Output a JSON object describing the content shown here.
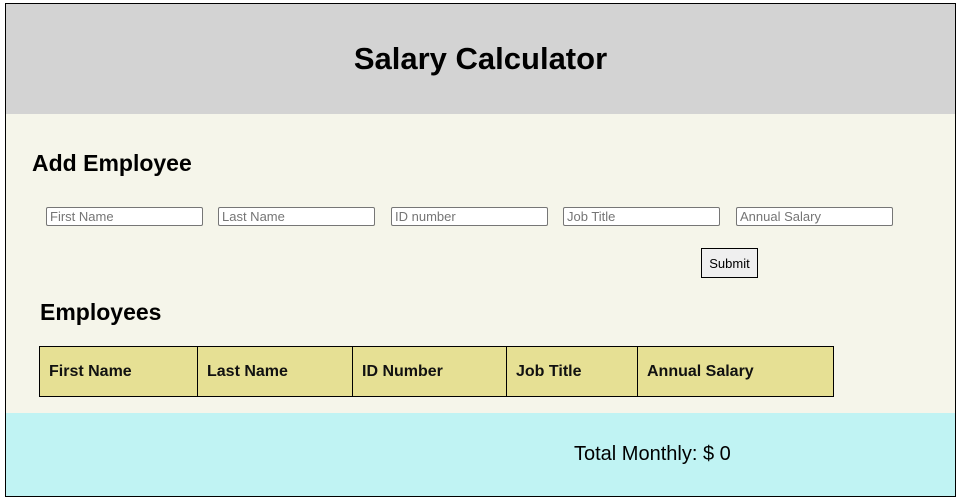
{
  "header": {
    "title": "Salary Calculator"
  },
  "form": {
    "heading": "Add Employee",
    "fields": [
      {
        "placeholder": "First Name",
        "value": ""
      },
      {
        "placeholder": "Last Name",
        "value": ""
      },
      {
        "placeholder": "ID number",
        "value": ""
      },
      {
        "placeholder": "Job Title",
        "value": ""
      },
      {
        "placeholder": "Annual Salary",
        "value": ""
      }
    ],
    "submit_label": "Submit"
  },
  "employees": {
    "heading": "Employees",
    "columns": [
      "First Name",
      "Last Name",
      "ID Number",
      "Job Title",
      "Annual Salary"
    ],
    "rows": []
  },
  "footer": {
    "total_label": "Total Monthly: $ 0"
  },
  "colors": {
    "header_bg": "#d3d3d3",
    "body_bg": "#f5f5ea",
    "table_header_bg": "#e6e094",
    "footer_bg": "#c0f3f3"
  }
}
